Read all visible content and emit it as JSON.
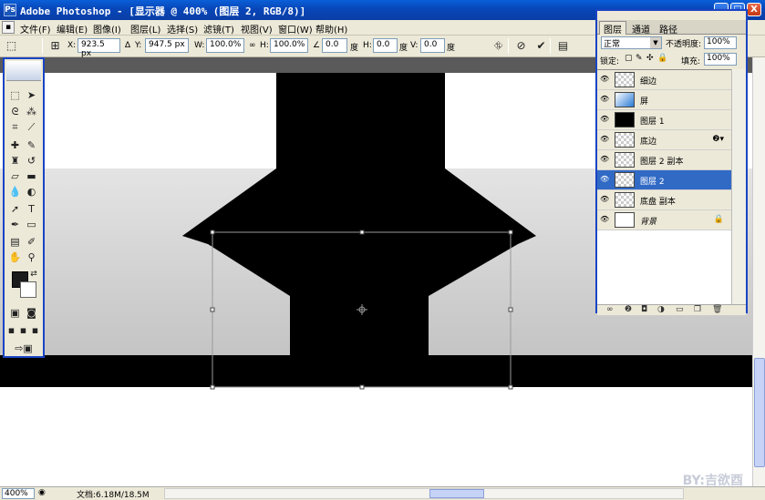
{
  "window": {
    "title": "Adobe Photoshop - [显示器 @ 400% (图层 2, RGB/8)]",
    "app_icon": "Ps",
    "controls": {
      "minimize": "_",
      "maximize": "□",
      "close": "X"
    }
  },
  "menubar": {
    "items": [
      "文件(F)",
      "编辑(E)",
      "图像(I)",
      "图层(L)",
      "选择(S)",
      "滤镜(T)",
      "视图(V)",
      "窗口(W)",
      "帮助(H)"
    ]
  },
  "options": {
    "x_label": "X:",
    "x_value": "923.5 px",
    "y_label": "Y:",
    "y_value": "947.5 px",
    "w_label": "W:",
    "w_value": "100.0%",
    "h_label": "H:",
    "h_value": "100.0%",
    "angle_value": "0.0",
    "angle_unit": "度",
    "hskew_label": "H:",
    "hskew_value": "0.0",
    "hskew_unit": "度",
    "vskew_label": "V:",
    "vskew_value": "0.0",
    "vskew_unit": "度",
    "cancel_icon": "cancel-icon",
    "commit_icon": "check-icon"
  },
  "layers_panel": {
    "tabs": [
      "图层",
      "通道",
      "路径"
    ],
    "blend_mode": "正常",
    "opacity_label": "不透明度:",
    "opacity_value": "100%",
    "lock_label": "锁定:",
    "fill_label": "填充:",
    "fill_value": "100%",
    "layers": [
      {
        "name": "细边",
        "visible": true,
        "selected": false,
        "thumb": "transparent"
      },
      {
        "name": "屏",
        "visible": true,
        "selected": false,
        "thumb": "blue-gradient"
      },
      {
        "name": "图层 1",
        "visible": true,
        "selected": false,
        "thumb": "black"
      },
      {
        "name": "底边",
        "visible": true,
        "selected": false,
        "thumb": "transparent",
        "badge": "fx"
      },
      {
        "name": "图层 2 副本",
        "visible": true,
        "selected": false,
        "thumb": "transparent"
      },
      {
        "name": "图层 2",
        "visible": true,
        "selected": true,
        "thumb": "transparent"
      },
      {
        "name": "底盘 副本",
        "visible": true,
        "selected": false,
        "thumb": "transparent"
      },
      {
        "name": "背景",
        "visible": true,
        "selected": false,
        "thumb": "white",
        "badge": "lock"
      }
    ]
  },
  "statusbar": {
    "zoom": "400%",
    "doc_info": "文档:6.18M/18.5M"
  },
  "watermark": "BY:吉欲酉"
}
